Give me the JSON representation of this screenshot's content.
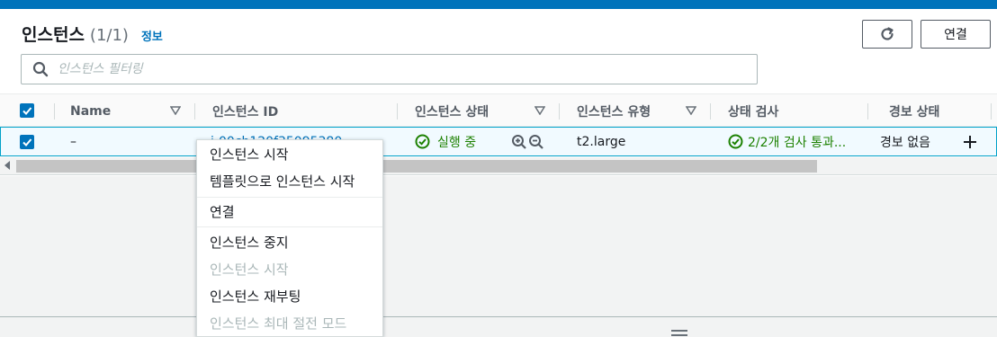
{
  "header": {
    "title": "인스턴스",
    "count": "(1/1)",
    "info_link": "정보"
  },
  "actions": {
    "refresh_icon": "refresh-icon",
    "connect_label": "연결"
  },
  "search": {
    "placeholder": "인스턴스 필터링",
    "value": ""
  },
  "table": {
    "columns": [
      "Name",
      "인스턴스 ID",
      "인스턴스 상태",
      "인스턴스 유형",
      "상태 검사",
      "경보 상태"
    ],
    "row": {
      "selected": true,
      "name": "–",
      "instance_id": "i-00cb120f35095380",
      "state": "실행 중",
      "type": "t2.large",
      "status_check": "2/2개 검사 통과...",
      "alarm": "경보 없음"
    }
  },
  "context_menu": {
    "items": [
      {
        "label": "인스턴스 시작",
        "disabled": false
      },
      {
        "label": "템플릿으로 인스턴스 시작",
        "disabled": false
      },
      {
        "label": "연결",
        "disabled": false
      },
      {
        "label": "인스턴스 중지",
        "disabled": false
      },
      {
        "label": "인스턴스 시작",
        "disabled": true
      },
      {
        "label": "인스턴스 재부팅",
        "disabled": false
      },
      {
        "label": "인스턴스 최대 절전 모드",
        "disabled": true
      }
    ]
  },
  "colors": {
    "accent": "#0073bb",
    "success": "#1d8102",
    "disabled": "#aab7b8"
  }
}
